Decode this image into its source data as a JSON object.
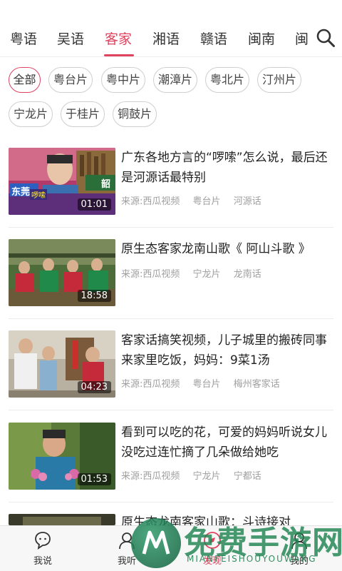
{
  "tabs": [
    "粤语",
    "吴语",
    "客家",
    "湘语",
    "赣语",
    "闽南",
    "闽"
  ],
  "active_tab": "客家",
  "chips": [
    "全部",
    "粤台片",
    "粤中片",
    "潮漳片",
    "粤北片",
    "汀州片",
    "宁龙片",
    "于桂片",
    "铜鼓片"
  ],
  "active_chip": "全部",
  "feed": [
    {
      "title": "广东各地方言的“啰嗦”怎么说，最后还是河源话最特别",
      "duration": "01:01",
      "source": "来源:西瓜视频",
      "tag1": "粤台片",
      "tag2": "河源话"
    },
    {
      "title": "原生态客家龙南山歌《 阿山斗歌 》",
      "duration": "18:58",
      "source": "来源:西瓜视频",
      "tag1": "宁龙片",
      "tag2": "龙南话"
    },
    {
      "title": "客家话搞笑视频，儿子城里的搬砖同事来家里吃饭，妈妈：9菜1汤",
      "duration": "04:23",
      "source": "来源:西瓜视频",
      "tag1": "粤台片",
      "tag2": "梅州客家话"
    },
    {
      "title": "看到可以吃的花，可爱的妈妈听说女儿没吃过连忙摘了几朵做给她吃",
      "duration": "01:53",
      "source": "来源:西瓜视频",
      "tag1": "宁龙片",
      "tag2": "宁都话"
    },
    {
      "title": "原生态龙南客家山歌：斗诗接对",
      "duration": "",
      "source": "",
      "tag1": "",
      "tag2": ""
    }
  ],
  "thumb_overlay_text": {
    "t1_a": "东莞",
    "t1_b": "啰嗦",
    "t1_c": "韶"
  },
  "bottom_nav": [
    "我说",
    "我听",
    "发现",
    "我的"
  ],
  "active_nav": "发现",
  "watermark": {
    "main": "免费手游网",
    "sub": "MIANFEISHOUYOUWANG"
  },
  "icons": {
    "search": "search-icon",
    "nav_speak": "speech-bubble-icon",
    "nav_listen": "person-listen-icon",
    "nav_discover": "discover-icon",
    "nav_me": "person-icon"
  },
  "colors": {
    "accent": "#e0435e",
    "watermark": "#1e8250"
  }
}
